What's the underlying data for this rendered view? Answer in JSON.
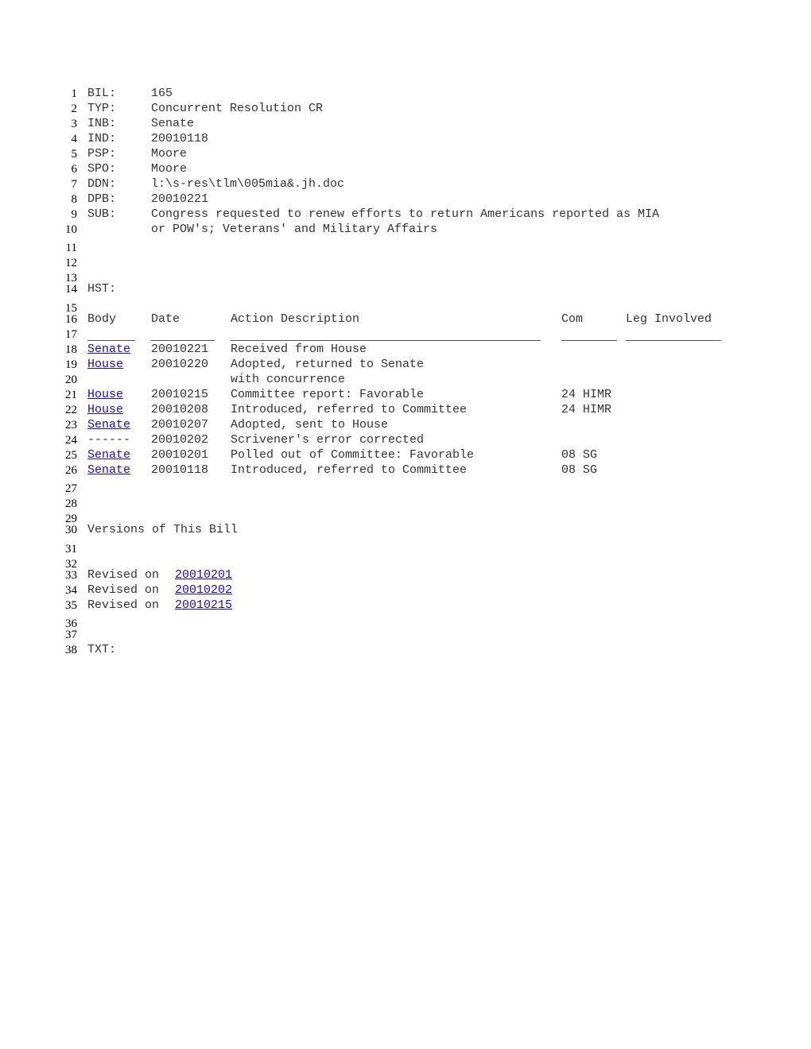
{
  "header": {
    "fields": [
      {
        "label": "BIL:",
        "value": "165"
      },
      {
        "label": "TYP:",
        "value": "Concurrent Resolution CR"
      },
      {
        "label": "INB:",
        "value": "Senate"
      },
      {
        "label": "IND:",
        "value": "20010118"
      },
      {
        "label": "PSP:",
        "value": "Moore"
      },
      {
        "label": "SPO:",
        "value": "Moore"
      },
      {
        "label": "DDN:",
        "value": "l:\\s-res\\tlm\\005mia&.jh.doc"
      },
      {
        "label": "DPB:",
        "value": "20010221"
      },
      {
        "label": "SUB:",
        "value": "Congress requested to renew efforts to return Americans reported as MIA"
      }
    ],
    "sub_continuation": "or POW's; Veterans' and Military Affairs"
  },
  "history": {
    "label": "HST:",
    "columns": [
      "Body",
      "Date",
      "Action Description",
      "Com",
      "Leg Involved"
    ],
    "rows": [
      {
        "body": "Senate",
        "body_link": true,
        "date": "20010221",
        "action": "Received from House",
        "com": ""
      },
      {
        "body": "House",
        "body_link": true,
        "date": "20010220",
        "action": "Adopted, returned to Senate",
        "com": ""
      },
      {
        "body": "",
        "body_link": false,
        "date": "",
        "action": "with concurrence",
        "com": ""
      },
      {
        "body": "House",
        "body_link": true,
        "date": "20010215",
        "action": "Committee report: Favorable",
        "com": "24 HIMR"
      },
      {
        "body": "House",
        "body_link": true,
        "date": "20010208",
        "action": "Introduced, referred to Committee",
        "com": "24 HIMR"
      },
      {
        "body": "Senate",
        "body_link": true,
        "date": "20010207",
        "action": "Adopted, sent to House",
        "com": ""
      },
      {
        "body": "------",
        "body_link": false,
        "date": "20010202",
        "action": "Scrivener's error corrected",
        "com": ""
      },
      {
        "body": "Senate",
        "body_link": true,
        "date": "20010201",
        "action": "Polled out of Committee: Favorable",
        "com": "08 SG"
      },
      {
        "body": "Senate",
        "body_link": true,
        "date": "20010118",
        "action": "Introduced, referred to Committee",
        "com": "08 SG"
      }
    ]
  },
  "versions": {
    "title": "Versions of This Bill",
    "prefix": "Revised on",
    "items": [
      "20010201",
      "20010202",
      "20010215"
    ]
  },
  "text_label": "TXT:",
  "line_numbers": [
    "1",
    "2",
    "3",
    "4",
    "5",
    "6",
    "7",
    "8",
    "9",
    "10",
    "11",
    "12",
    "13",
    "14",
    "15",
    "16",
    "17",
    "18",
    "19",
    "20",
    "21",
    "22",
    "23",
    "24",
    "25",
    "26",
    "27",
    "28",
    "29",
    "30",
    "31",
    "32",
    "33",
    "34",
    "35",
    "36",
    "37",
    "38"
  ]
}
